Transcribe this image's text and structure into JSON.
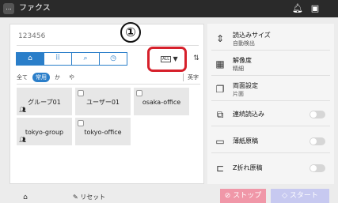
{
  "header": {
    "menu_label": "...",
    "title": "ファクス",
    "bell_icon": "bell-icon",
    "copy_icon": "device-icon"
  },
  "address": {
    "placeholder": "123456"
  },
  "tabs": [
    {
      "name": "address-book",
      "label": "⌂",
      "icon": "address-book-icon",
      "active": true
    },
    {
      "name": "keypad",
      "label": "⠿",
      "icon": "keypad-icon",
      "active": false
    },
    {
      "name": "search",
      "label": "⌕",
      "icon": "search-icon",
      "active": false
    },
    {
      "name": "history",
      "label": "◷",
      "icon": "history-icon",
      "active": false
    }
  ],
  "filter": {
    "label": "ALL",
    "sort_icon": "sort-icon"
  },
  "callout": "①",
  "index": {
    "items": [
      "全て",
      "常用",
      "か",
      "や",
      "英字"
    ],
    "active": "常用"
  },
  "destinations": [
    {
      "name": "グループ01",
      "group": true
    },
    {
      "name": "ユーザー01",
      "group": false
    },
    {
      "name": "osaka-office",
      "group": false
    },
    {
      "name": "tokyo-group",
      "group": true
    },
    {
      "name": "tokyo-office",
      "group": false
    }
  ],
  "settings": [
    {
      "title": "読込みサイズ",
      "sub": "自動検出",
      "icon": "scan-size-icon",
      "toggle": null
    },
    {
      "title": "解像度",
      "sub": "精細",
      "icon": "resolution-icon",
      "toggle": null
    },
    {
      "title": "両面設定",
      "sub": "片面",
      "icon": "duplex-icon",
      "toggle": null
    },
    {
      "title": "連続読込み",
      "sub": "",
      "icon": "continuous-scan-icon",
      "toggle": false
    },
    {
      "title": "薄紙原稿",
      "sub": "",
      "icon": "thin-paper-icon",
      "toggle": false
    },
    {
      "title": "Z折れ原稿",
      "sub": "",
      "icon": "z-fold-icon",
      "toggle": false
    }
  ],
  "bottom": {
    "home_icon": "home-icon",
    "reset_label": "リセット",
    "stop_label": "ストップ",
    "start_label": "スタート"
  },
  "colors": {
    "accent": "#2a7ec9",
    "highlight": "#d6202b",
    "stop": "#f097a8",
    "start": "#c7c9f0"
  }
}
